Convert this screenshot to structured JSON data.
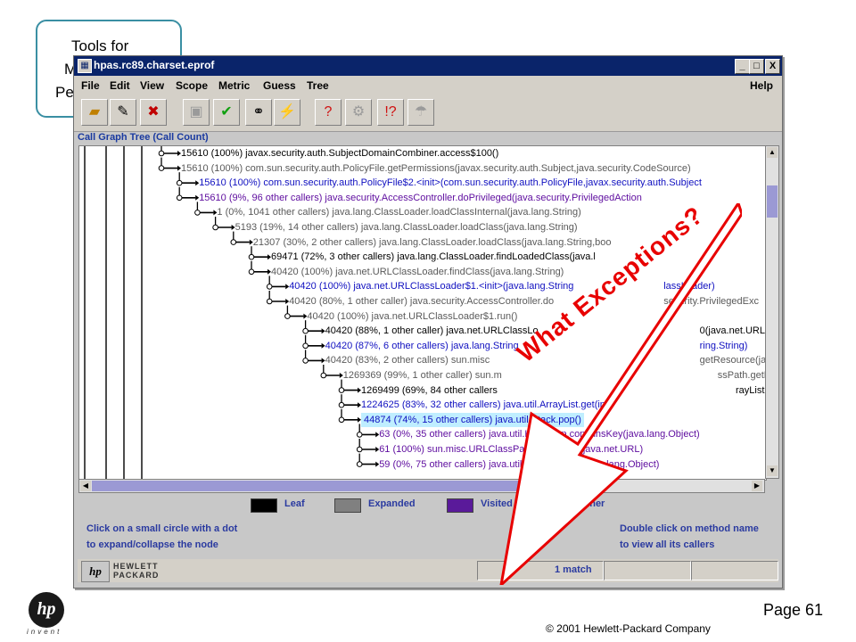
{
  "slide": {
    "callout_lines": [
      "Tools for",
      "M",
      "Pe"
    ],
    "page_number": "Page 61",
    "copyright": "© 2001 Hewlett-Packard  Company",
    "logo_text": "hp",
    "logo_tagline": "invent",
    "overlay_text": "What Exceptions?"
  },
  "window": {
    "title": "hpas.rc89.charset.eprof",
    "controls": [
      "_",
      "□",
      "X"
    ],
    "menus": [
      "File",
      "Edit",
      "View",
      "Scope",
      "Metric",
      "Guess",
      "Tree"
    ],
    "help_menu": "Help",
    "toolbar_icons": [
      "open-folder-icon",
      "script-icon",
      "close-file-icon",
      "save-icon",
      "checkmark-icon",
      "binoculars-icon",
      "find-next-icon",
      "tree-guess-icon",
      "tree-cycles-icon",
      "exception-guess-icon",
      "rain-icon"
    ]
  },
  "panel": {
    "title": "Call Graph Tree (Call Count)",
    "rows": [
      {
        "text": "15610 (100%) javax.security.auth.SubjectDomainCombiner.access$100()",
        "color": "black",
        "indent": 0
      },
      {
        "text": "15610 (100%) com.sun.security.auth.PolicyFile.getPermissions(javax.security.auth.Subject,java.security.CodeSource)",
        "color": "gray",
        "indent": 0
      },
      {
        "text": "15610 (100%) com.sun.security.auth.PolicyFile$2.<init>(com.sun.security.auth.PolicyFile,javax.security.auth.Subject",
        "color": "blue",
        "indent": 1
      },
      {
        "text": "15610 (9%, 96 other callers) java.security.AccessController.doPrivileged(java.security.PrivilegedAction",
        "color": "purple",
        "indent": 1
      },
      {
        "text": "1 (0%, 1041 other callers) java.lang.ClassLoader.loadClassInternal(java.lang.String)",
        "color": "gray",
        "indent": 2
      },
      {
        "text": "5193 (19%, 14 other callers) java.lang.ClassLoader.loadClass(java.lang.String)",
        "color": "gray",
        "indent": 3
      },
      {
        "text": "21307 (30%, 2 other callers) java.lang.ClassLoader.loadClass(java.lang.String,boo",
        "color": "gray",
        "indent": 4
      },
      {
        "text": "69471 (72%, 3 other callers) java.lang.ClassLoader.findLoadedClass(java.l",
        "color": "black",
        "indent": 5
      },
      {
        "text": "40420 (100%) java.net.URLClassLoader.findClass(java.lang.String)",
        "color": "gray",
        "indent": 5
      },
      {
        "text": "40420 (100%) java.net.URLClassLoader$1.<init>(java.lang.String",
        "color": "blue",
        "indent": 6
      },
      {
        "text": "40420 (80%, 1 other caller) java.security.AccessController.do",
        "color": "gray",
        "indent": 6
      },
      {
        "text": "40420 (100%) java.net.URLClassLoader$1.run()",
        "color": "gray",
        "indent": 7
      },
      {
        "text": "40420 (88%, 1 other caller) java.net.URLClassLo",
        "color": "black",
        "indent": 8
      },
      {
        "text": "40420 (87%, 6 other callers) java.lang.String",
        "color": "blue",
        "indent": 8
      },
      {
        "text": "40420 (83%, 2 other callers) sun.misc",
        "color": "gray",
        "indent": 8
      },
      {
        "text": "1269369 (99%, 1 other caller) sun.m",
        "color": "gray",
        "indent": 9
      },
      {
        "text": "1269499 (69%, 84 other callers",
        "color": "black",
        "indent": 10
      },
      {
        "text": "1224625 (83%, 32 other callers) java.util.ArrayList.get(int)",
        "color": "blue",
        "indent": 10
      },
      {
        "text": "44874 (74%, 15 other callers) java.util.Stack.pop()",
        "color": "blue",
        "indent": 10,
        "selected": true
      },
      {
        "text": "63 (0%, 35 other callers) java.util.HashMap.containsKey(java.lang.Object)",
        "color": "purple",
        "indent": 11
      },
      {
        "text": "61 (100%) sun.misc.URLClassPath.getLoader(java.net.URL)",
        "color": "purple",
        "indent": 11
      },
      {
        "text": "59 (0%, 75 other callers) java.util.ArrayList.add(java.lang.Object)",
        "color": "purple",
        "indent": 11
      }
    ],
    "row_suffixes": {
      "12": "0(java.net.URLClassLoader",
      "13": "ring.String)",
      "14": "getResource(java.lang.String,boolea",
      "15": "ssPath.getLoader(int)",
      "16": "rayList.size()",
      "7": "",
      "9": "lassLoader)",
      "10": "security.PrivilegedExc"
    }
  },
  "legend": {
    "items": [
      {
        "label": "Leaf",
        "color": "#000000"
      },
      {
        "label": "Expanded",
        "color": "#808080"
      },
      {
        "label": "Visited",
        "color": "#5a1a9a"
      },
      {
        "label": "Other",
        "color": "#0a10f0"
      }
    ]
  },
  "help": {
    "left_line1": "Click on a small circle with a dot",
    "left_line2": "to expand/collapse the node",
    "right_line1": "Double click on method name",
    "right_line2": "to view all its callers"
  },
  "status": {
    "logo": "hp",
    "brand_line1": "HEWLETT",
    "brand_line2": "PACKARD",
    "match": "1 match"
  },
  "colors": {
    "black": "#000000",
    "gray": "#5a5a5a",
    "purple": "#6010a0",
    "blue": "#1010c0",
    "overlay_red": "#e80000",
    "titlebar": "#0a246a"
  }
}
